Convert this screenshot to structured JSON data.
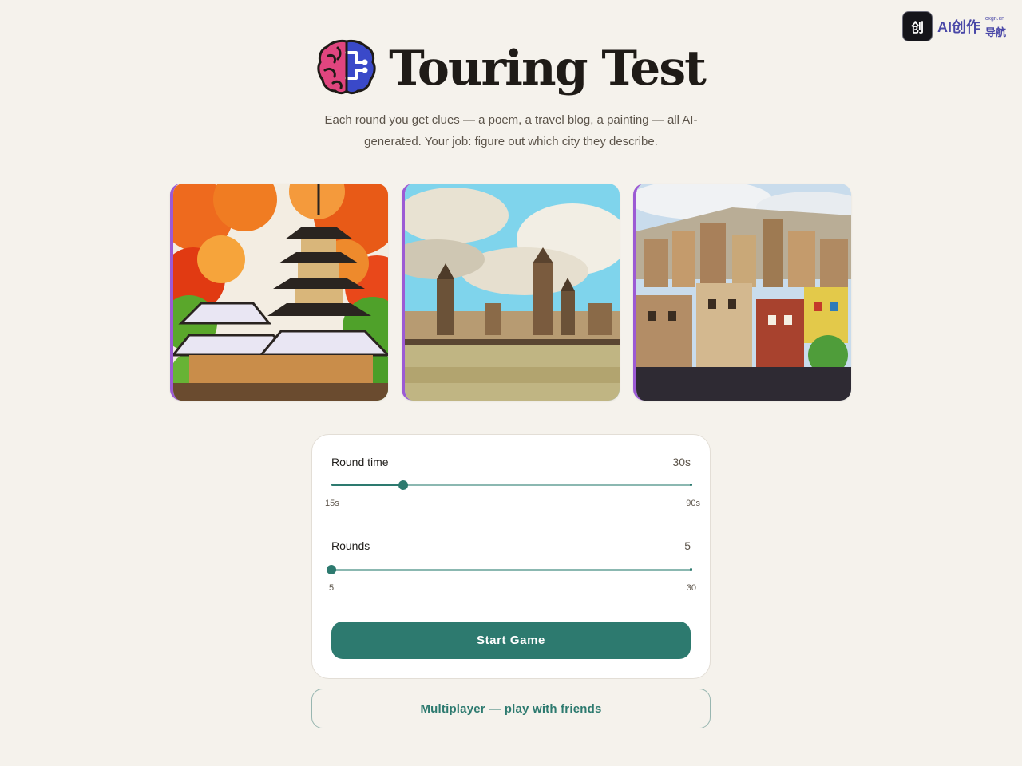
{
  "corner_brand": {
    "logo_text": "创",
    "name": "AI创作",
    "sub_small": "cxgn.cn",
    "sub_large": "导航"
  },
  "header": {
    "title": "Touring Test",
    "logo_icon": "brain-icon",
    "subtitle": "Each round you get clues — a poem, a travel blog, a painting — all AI-generated. Your job: figure out which city they describe."
  },
  "paintings": [
    {
      "subject": "pagoda among autumn trees"
    },
    {
      "subject": "cathedral skyline across a river"
    },
    {
      "subject": "hillside city of tall mudbrick houses"
    }
  ],
  "settings": {
    "round_time": {
      "label": "Round time",
      "value": "30s",
      "min_label": "15s",
      "max_label": "90s",
      "fraction": 0.2
    },
    "rounds": {
      "label": "Rounds",
      "value": "5",
      "min_label": "5",
      "max_label": "30",
      "fraction": 0.0
    },
    "start_label": "Start Game"
  },
  "multiplayer_label": "Multiplayer — play with friends",
  "colors": {
    "accent": "#2d7a6f",
    "background": "#f5f2ec",
    "painting_border": "#9c5ad4"
  }
}
